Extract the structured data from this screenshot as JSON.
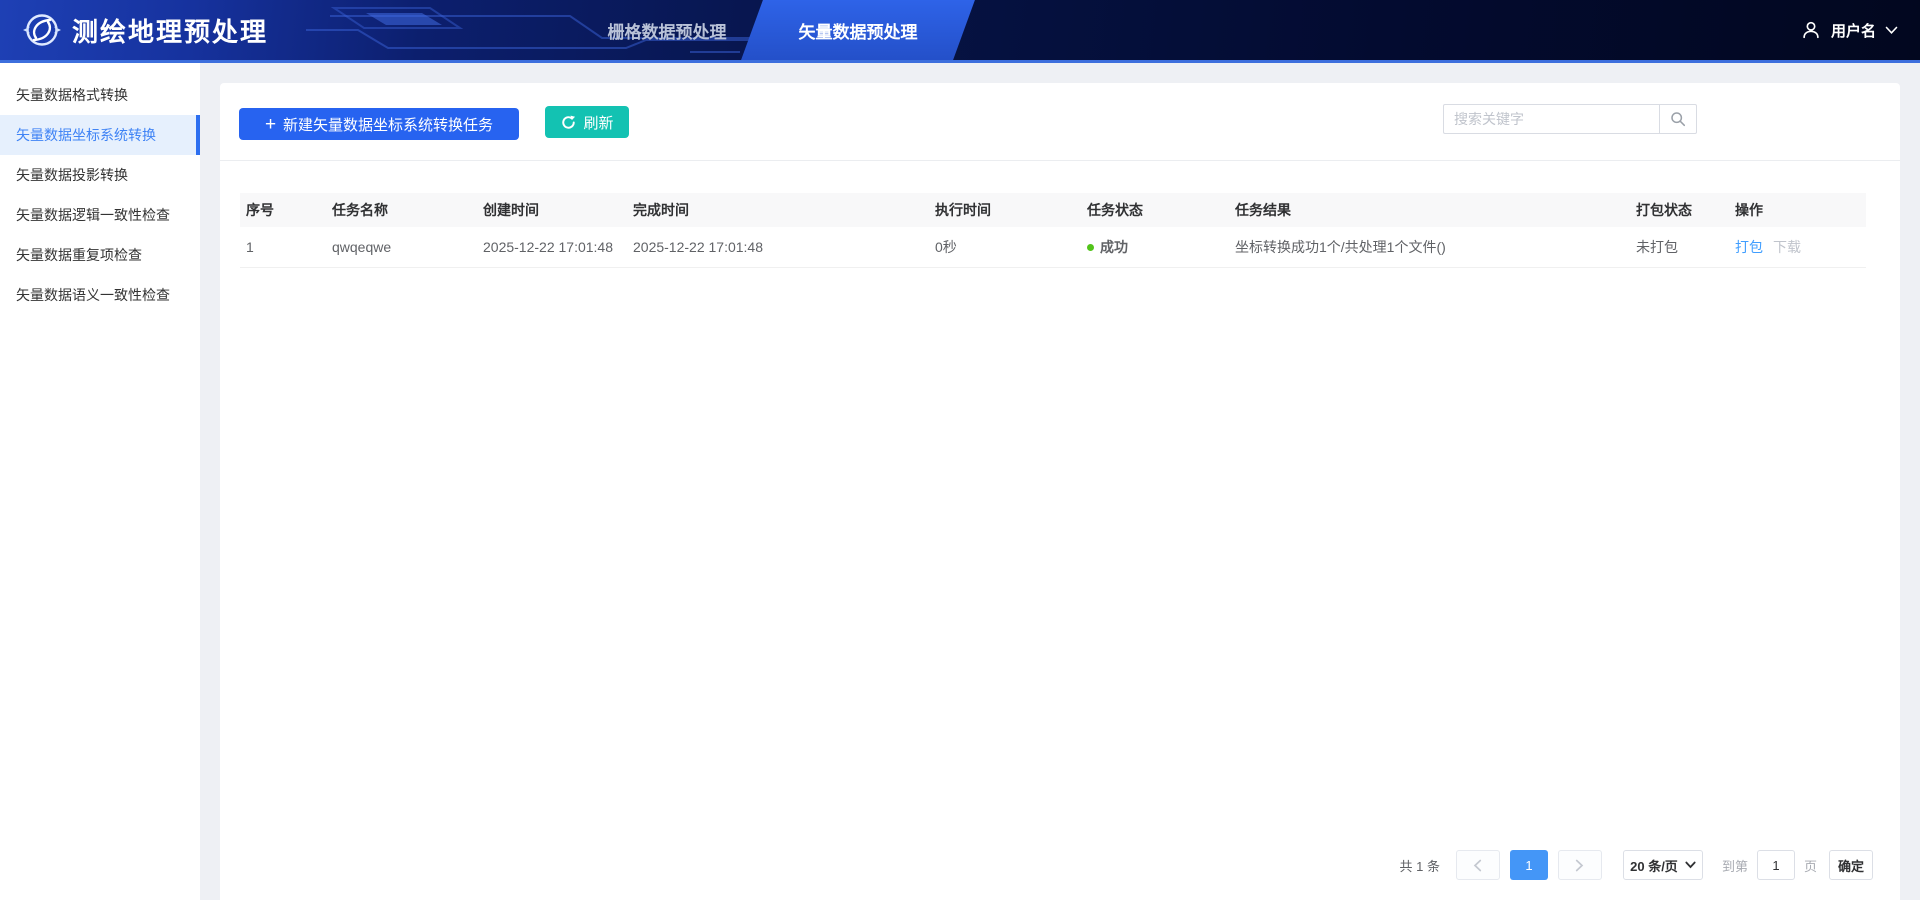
{
  "header": {
    "app_title": "测绘地理预处理",
    "tabs": [
      {
        "label": "栅格数据预处理",
        "active": false
      },
      {
        "label": "矢量数据预处理",
        "active": true
      }
    ],
    "username": "用户名"
  },
  "sidebar": {
    "items": [
      {
        "label": "矢量数据格式转换",
        "active": false
      },
      {
        "label": "矢量数据坐标系统转换",
        "active": true
      },
      {
        "label": "矢量数据投影转换",
        "active": false
      },
      {
        "label": "矢量数据逻辑一致性检查",
        "active": false
      },
      {
        "label": "矢量数据重复项检查",
        "active": false
      },
      {
        "label": "矢量数据语义一致性检查",
        "active": false
      }
    ]
  },
  "toolbar": {
    "new_task_label": "新建矢量数据坐标系统转换任务",
    "refresh_label": "刷新",
    "search_placeholder": "搜索关键字"
  },
  "table": {
    "columns": [
      "序号",
      "任务名称",
      "创建时间",
      "完成时间",
      "执行时间",
      "任务状态",
      "任务结果",
      "打包状态",
      "操作"
    ],
    "rows": [
      {
        "index": "1",
        "name": "qwqeqwe",
        "created": "2025-12-22 17:01:48",
        "finished": "2025-12-22 17:01:48",
        "duration": "0秒",
        "status": "成功",
        "result": "坐标转换成功1个/共处理1个文件()",
        "package_status": "未打包",
        "action_package": "打包",
        "action_download": "下载"
      }
    ]
  },
  "pagination": {
    "total_label": "共 1 条",
    "current_page": "1",
    "page_size_label": "20 条/页",
    "goto_prefix": "到第",
    "goto_value": "1",
    "goto_suffix": "页",
    "confirm_label": "确定"
  },
  "colors": {
    "header_navy": "#030b30",
    "header_accent_line": "#3d6fdd",
    "active_tab_blue": "#2a58d8",
    "primary_button_blue": "#2763f0",
    "refresh_teal": "#13c2b2",
    "sidebar_active_blue": "#2d6ff0",
    "success_green": "#52c41a",
    "link_blue": "#409eff",
    "pager_active_blue": "#4496f7"
  }
}
